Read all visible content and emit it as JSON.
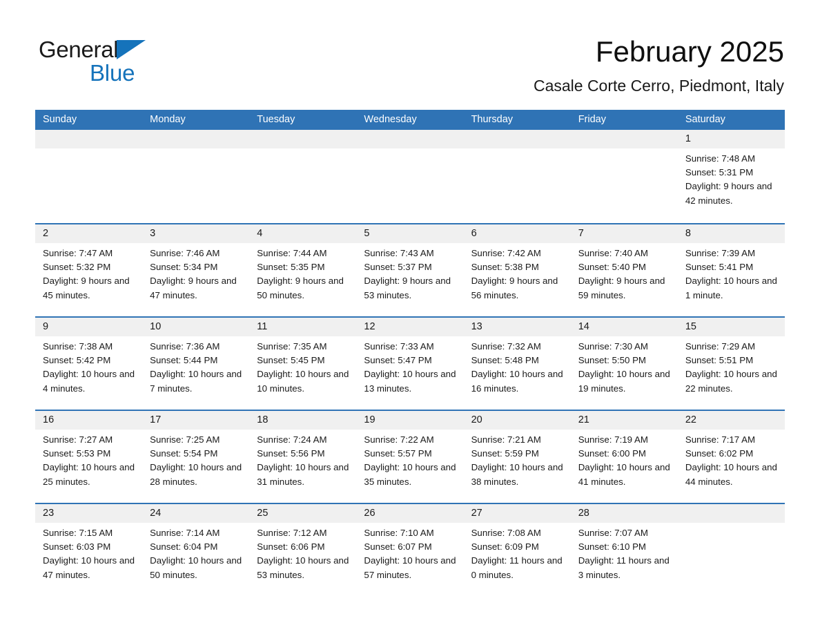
{
  "brand": {
    "name_part1": "General",
    "name_part2": "Blue",
    "triangle_color": "#1573bb"
  },
  "header": {
    "month_title": "February 2025",
    "location": "Casale Corte Cerro, Piedmont, Italy",
    "accent_color": "#2f73b5"
  },
  "weekdays": [
    {
      "label": "Sunday"
    },
    {
      "label": "Monday"
    },
    {
      "label": "Tuesday"
    },
    {
      "label": "Wednesday"
    },
    {
      "label": "Thursday"
    },
    {
      "label": "Friday"
    },
    {
      "label": "Saturday"
    }
  ],
  "weeks": [
    {
      "days": [
        {
          "number": "",
          "sunrise": "",
          "sunset": "",
          "daylight": "",
          "empty": true
        },
        {
          "number": "",
          "sunrise": "",
          "sunset": "",
          "daylight": "",
          "empty": true
        },
        {
          "number": "",
          "sunrise": "",
          "sunset": "",
          "daylight": "",
          "empty": true
        },
        {
          "number": "",
          "sunrise": "",
          "sunset": "",
          "daylight": "",
          "empty": true
        },
        {
          "number": "",
          "sunrise": "",
          "sunset": "",
          "daylight": "",
          "empty": true
        },
        {
          "number": "",
          "sunrise": "",
          "sunset": "",
          "daylight": "",
          "empty": true
        },
        {
          "number": "1",
          "sunrise": "Sunrise: 7:48 AM",
          "sunset": "Sunset: 5:31 PM",
          "daylight": "Daylight: 9 hours and 42 minutes.",
          "empty": false
        }
      ]
    },
    {
      "days": [
        {
          "number": "2",
          "sunrise": "Sunrise: 7:47 AM",
          "sunset": "Sunset: 5:32 PM",
          "daylight": "Daylight: 9 hours and 45 minutes.",
          "empty": false
        },
        {
          "number": "3",
          "sunrise": "Sunrise: 7:46 AM",
          "sunset": "Sunset: 5:34 PM",
          "daylight": "Daylight: 9 hours and 47 minutes.",
          "empty": false
        },
        {
          "number": "4",
          "sunrise": "Sunrise: 7:44 AM",
          "sunset": "Sunset: 5:35 PM",
          "daylight": "Daylight: 9 hours and 50 minutes.",
          "empty": false
        },
        {
          "number": "5",
          "sunrise": "Sunrise: 7:43 AM",
          "sunset": "Sunset: 5:37 PM",
          "daylight": "Daylight: 9 hours and 53 minutes.",
          "empty": false
        },
        {
          "number": "6",
          "sunrise": "Sunrise: 7:42 AM",
          "sunset": "Sunset: 5:38 PM",
          "daylight": "Daylight: 9 hours and 56 minutes.",
          "empty": false
        },
        {
          "number": "7",
          "sunrise": "Sunrise: 7:40 AM",
          "sunset": "Sunset: 5:40 PM",
          "daylight": "Daylight: 9 hours and 59 minutes.",
          "empty": false
        },
        {
          "number": "8",
          "sunrise": "Sunrise: 7:39 AM",
          "sunset": "Sunset: 5:41 PM",
          "daylight": "Daylight: 10 hours and 1 minute.",
          "empty": false
        }
      ]
    },
    {
      "days": [
        {
          "number": "9",
          "sunrise": "Sunrise: 7:38 AM",
          "sunset": "Sunset: 5:42 PM",
          "daylight": "Daylight: 10 hours and 4 minutes.",
          "empty": false
        },
        {
          "number": "10",
          "sunrise": "Sunrise: 7:36 AM",
          "sunset": "Sunset: 5:44 PM",
          "daylight": "Daylight: 10 hours and 7 minutes.",
          "empty": false
        },
        {
          "number": "11",
          "sunrise": "Sunrise: 7:35 AM",
          "sunset": "Sunset: 5:45 PM",
          "daylight": "Daylight: 10 hours and 10 minutes.",
          "empty": false
        },
        {
          "number": "12",
          "sunrise": "Sunrise: 7:33 AM",
          "sunset": "Sunset: 5:47 PM",
          "daylight": "Daylight: 10 hours and 13 minutes.",
          "empty": false
        },
        {
          "number": "13",
          "sunrise": "Sunrise: 7:32 AM",
          "sunset": "Sunset: 5:48 PM",
          "daylight": "Daylight: 10 hours and 16 minutes.",
          "empty": false
        },
        {
          "number": "14",
          "sunrise": "Sunrise: 7:30 AM",
          "sunset": "Sunset: 5:50 PM",
          "daylight": "Daylight: 10 hours and 19 minutes.",
          "empty": false
        },
        {
          "number": "15",
          "sunrise": "Sunrise: 7:29 AM",
          "sunset": "Sunset: 5:51 PM",
          "daylight": "Daylight: 10 hours and 22 minutes.",
          "empty": false
        }
      ]
    },
    {
      "days": [
        {
          "number": "16",
          "sunrise": "Sunrise: 7:27 AM",
          "sunset": "Sunset: 5:53 PM",
          "daylight": "Daylight: 10 hours and 25 minutes.",
          "empty": false
        },
        {
          "number": "17",
          "sunrise": "Sunrise: 7:25 AM",
          "sunset": "Sunset: 5:54 PM",
          "daylight": "Daylight: 10 hours and 28 minutes.",
          "empty": false
        },
        {
          "number": "18",
          "sunrise": "Sunrise: 7:24 AM",
          "sunset": "Sunset: 5:56 PM",
          "daylight": "Daylight: 10 hours and 31 minutes.",
          "empty": false
        },
        {
          "number": "19",
          "sunrise": "Sunrise: 7:22 AM",
          "sunset": "Sunset: 5:57 PM",
          "daylight": "Daylight: 10 hours and 35 minutes.",
          "empty": false
        },
        {
          "number": "20",
          "sunrise": "Sunrise: 7:21 AM",
          "sunset": "Sunset: 5:59 PM",
          "daylight": "Daylight: 10 hours and 38 minutes.",
          "empty": false
        },
        {
          "number": "21",
          "sunrise": "Sunrise: 7:19 AM",
          "sunset": "Sunset: 6:00 PM",
          "daylight": "Daylight: 10 hours and 41 minutes.",
          "empty": false
        },
        {
          "number": "22",
          "sunrise": "Sunrise: 7:17 AM",
          "sunset": "Sunset: 6:02 PM",
          "daylight": "Daylight: 10 hours and 44 minutes.",
          "empty": false
        }
      ]
    },
    {
      "days": [
        {
          "number": "23",
          "sunrise": "Sunrise: 7:15 AM",
          "sunset": "Sunset: 6:03 PM",
          "daylight": "Daylight: 10 hours and 47 minutes.",
          "empty": false
        },
        {
          "number": "24",
          "sunrise": "Sunrise: 7:14 AM",
          "sunset": "Sunset: 6:04 PM",
          "daylight": "Daylight: 10 hours and 50 minutes.",
          "empty": false
        },
        {
          "number": "25",
          "sunrise": "Sunrise: 7:12 AM",
          "sunset": "Sunset: 6:06 PM",
          "daylight": "Daylight: 10 hours and 53 minutes.",
          "empty": false
        },
        {
          "number": "26",
          "sunrise": "Sunrise: 7:10 AM",
          "sunset": "Sunset: 6:07 PM",
          "daylight": "Daylight: 10 hours and 57 minutes.",
          "empty": false
        },
        {
          "number": "27",
          "sunrise": "Sunrise: 7:08 AM",
          "sunset": "Sunset: 6:09 PM",
          "daylight": "Daylight: 11 hours and 0 minutes.",
          "empty": false
        },
        {
          "number": "28",
          "sunrise": "Sunrise: 7:07 AM",
          "sunset": "Sunset: 6:10 PM",
          "daylight": "Daylight: 11 hours and 3 minutes.",
          "empty": false
        },
        {
          "number": "",
          "sunrise": "",
          "sunset": "",
          "daylight": "",
          "empty": true
        }
      ]
    }
  ]
}
